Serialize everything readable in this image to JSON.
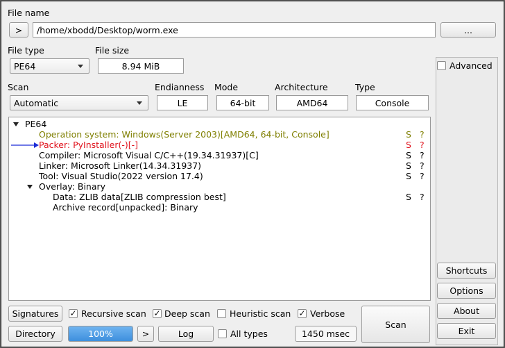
{
  "file_name": {
    "label": "File name",
    "open_button": ">",
    "path": "/home/xbodd/Desktop/worm.exe",
    "browse_button": "..."
  },
  "file_type": {
    "label": "File type",
    "value": "PE64"
  },
  "file_size": {
    "label": "File size",
    "value": "8.94 MiB"
  },
  "scan": {
    "label": "Scan",
    "value": "Automatic"
  },
  "endianness": {
    "label": "Endianness",
    "value": "LE"
  },
  "mode": {
    "label": "Mode",
    "value": "64-bit"
  },
  "architecture": {
    "label": "Architecture",
    "value": "AMD64"
  },
  "type": {
    "label": "Type",
    "value": "Console"
  },
  "advanced": {
    "label": "Advanced",
    "checked": false
  },
  "results": {
    "root": "PE64",
    "items": [
      {
        "text": "Operation system: Windows(Server 2003)[AMD64, 64-bit, Console]",
        "s": "S",
        "q": "?",
        "color": "#7f7f00"
      },
      {
        "text": "Packer: PyInstaller(-)[-]",
        "s": "S",
        "q": "?",
        "color": "#e0141e"
      },
      {
        "text": "Compiler: Microsoft Visual C/C++(19.34.31937)[C]",
        "s": "S",
        "q": "?",
        "color": "#000000"
      },
      {
        "text": "Linker: Microsoft Linker(14.34.31937)",
        "s": "S",
        "q": "?",
        "color": "#000000"
      },
      {
        "text": "Tool: Visual Studio(2022 version 17.4)",
        "s": "S",
        "q": "?",
        "color": "#000000"
      }
    ],
    "overlay": {
      "label": "Overlay: Binary",
      "children": [
        {
          "text": "Data: ZLIB data[ZLIB compression best]",
          "s": "S",
          "q": "?"
        },
        {
          "text": "Archive record[unpacked]: Binary",
          "s": "",
          "q": ""
        }
      ]
    }
  },
  "options": {
    "signatures": "Signatures",
    "recursive_scan": {
      "label": "Recursive scan",
      "checked": true
    },
    "deep_scan": {
      "label": "Deep scan",
      "checked": true
    },
    "heuristic_scan": {
      "label": "Heuristic scan",
      "checked": false
    },
    "verbose": {
      "label": "Verbose",
      "checked": true
    },
    "directory": "Directory",
    "progress": "100%",
    "progress_fraction": 1.0,
    "next": ">",
    "log": "Log",
    "all_types": {
      "label": "All types",
      "checked": false
    },
    "elapsed": "1450 msec",
    "scan_button": "Scan"
  },
  "side": {
    "shortcuts": "Shortcuts",
    "options": "Options",
    "about": "About",
    "exit": "Exit"
  },
  "colors": {
    "accent": "#3e8fdd",
    "arrow": "#1a2bd6"
  },
  "check_glyph": "✓"
}
